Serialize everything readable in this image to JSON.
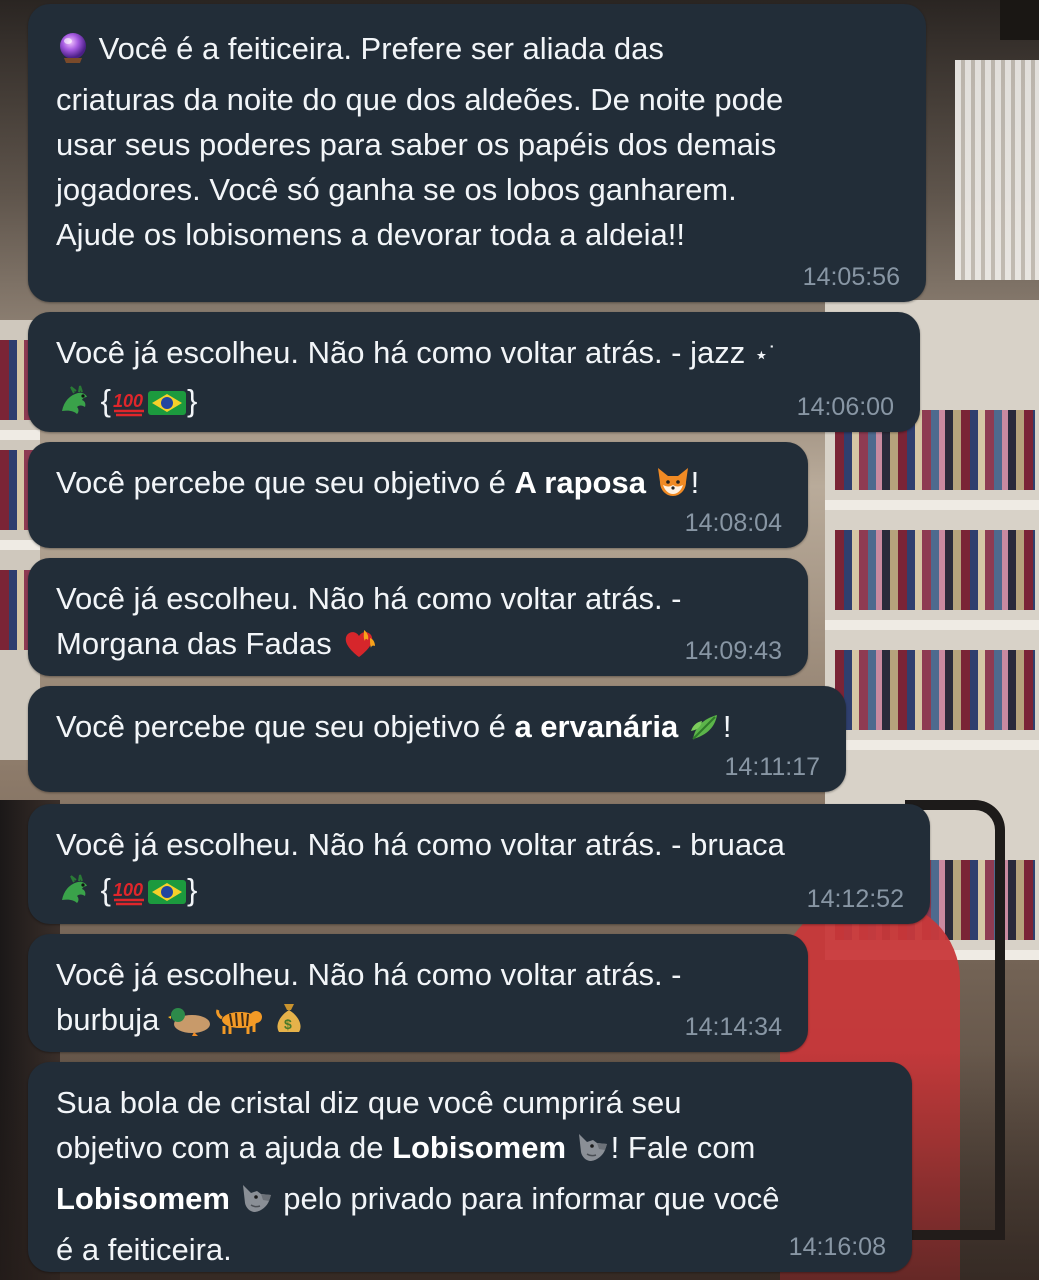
{
  "messages": [
    {
      "lines": [
        "Você é a feiticeira. Prefere ser aliada das",
        "criaturas da noite do que dos aldeões. De noite pode",
        "usar seus poderes para saber os papéis dos demais",
        "jogadores. Você só ganha se os lobos ganharem.",
        "Ajude os lobisomens a devorar toda a aldeia!!"
      ],
      "time": "14:05:56"
    },
    {
      "text_a": "Você já escolheu. Não há como voltar atrás. - jazz",
      "star": "⋆˙",
      "brace_open": "{",
      "brace_close": "}",
      "time": "14:06:00"
    },
    {
      "prefix": "Você percebe que seu objetivo é ",
      "role": "A raposa",
      "suffix": "!",
      "time": "14:08:04"
    },
    {
      "line1": "Você já escolheu. Não há como voltar atrás. -",
      "line2": "Morgana das Fadas",
      "time": "14:09:43"
    },
    {
      "prefix": "Você percebe que seu objetivo é ",
      "role": "a ervanária",
      "suffix": "!",
      "time": "14:11:17"
    },
    {
      "text_a": "Você já escolheu. Não há como voltar atrás. - bruaca",
      "brace_open": "{",
      "brace_close": "}",
      "time": "14:12:52"
    },
    {
      "line1": "Você já escolheu. Não há como voltar atrás. -",
      "line2": "burbuja",
      "time": "14:14:34"
    },
    {
      "l1": "Sua bola de cristal diz que você cumprirá seu",
      "l2a": "objetivo com a ajuda de ",
      "l2b": "Lobisomem",
      "l2c": "! Fale com",
      "l3a": "Lobisomem",
      "l3b": " pelo privado para informar que você",
      "l4": "é a feiticeira.",
      "time": "14:16:08"
    }
  ],
  "icons": {
    "crystal_ball": "crystal-ball-icon",
    "dragon": "dragon-icon",
    "hundred": "hundred-points-icon",
    "brazil_flag": "brazil-flag-icon",
    "fox": "fox-icon",
    "fire_heart": "heart-on-fire-icon",
    "herb": "herb-icon",
    "duck": "duck-icon",
    "tiger": "tiger-icon",
    "money_bag": "money-bag-icon",
    "wolf": "wolf-icon"
  },
  "colors": {
    "bubble": "#222d38",
    "text": "#f2f5f8",
    "time": "#8896a4"
  }
}
